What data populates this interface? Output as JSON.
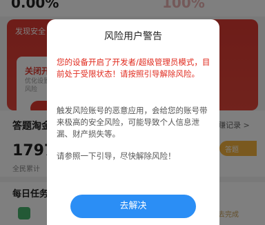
{
  "background": {
    "top_left_value": "0.00%",
    "top_right_value": "100%",
    "alert_card": {
      "title": "发现安全",
      "inner_title": "关闭开",
      "inner_text": "优化设置 检查风险"
    },
    "section_title": "答题淘金",
    "section_link": "赚记录 >",
    "big_number": "17979",
    "sub_label": "全民累计",
    "gold_button": "答题",
    "daily_title": "每日任务",
    "task_status": "去完成"
  },
  "dialog": {
    "title": "风险用户警告",
    "warning": "您的设备开启了开发者/超级管理员模式，目前处于受限状态！请按照引导解除风险。",
    "body": "触发风险账号的恶意应用，会给您的账号带来极高的安全风险，可能导致个人信息泄漏、财产损失等。",
    "guide": "请参照一下引导，尽快解除风险！",
    "button": "去解决"
  },
  "colors": {
    "accent_blue": "#2b8ef5",
    "warning_red": "#e02a1e",
    "card_red": "#dc3a32"
  }
}
